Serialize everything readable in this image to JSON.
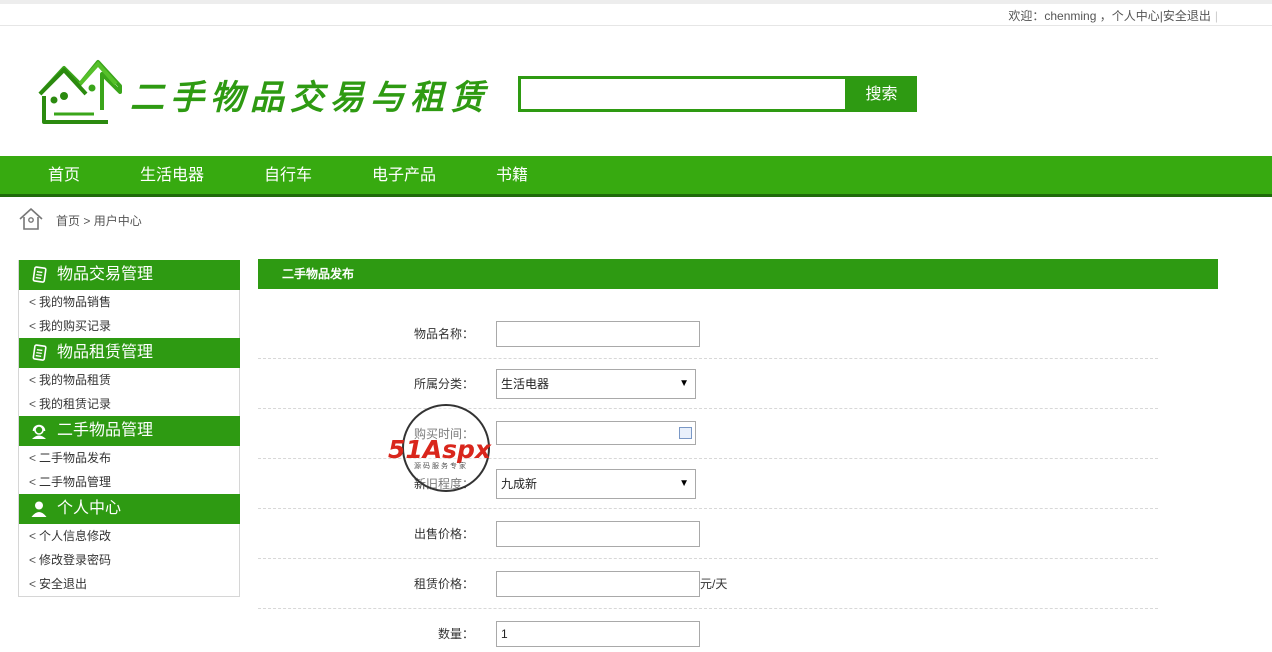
{
  "topbar": {
    "welcome": "欢迎：chenming ，",
    "user_center": "个人中心",
    "sep": "|",
    "logout": "安全退出",
    "tail": "|"
  },
  "header": {
    "site_title": "二手物品交易与租赁",
    "search_placeholder": "",
    "search_button": "搜索"
  },
  "nav": [
    "首页",
    "生活电器",
    "自行车",
    "电子产品",
    "书籍"
  ],
  "breadcrumb": {
    "home": "首页",
    "sep": ">",
    "current": "用户中心"
  },
  "sidebar": {
    "groups": [
      {
        "title": "物品交易管理",
        "icon": "document-icon",
        "items": [
          "我的物品销售",
          "我的购买记录"
        ]
      },
      {
        "title": "物品租赁管理",
        "icon": "document-icon",
        "items": [
          "我的物品租赁",
          "我的租赁记录"
        ]
      },
      {
        "title": "二手物品管理",
        "icon": "headset-user-icon",
        "items": [
          "二手物品发布",
          "二手物品管理"
        ]
      },
      {
        "title": "个人中心",
        "icon": "user-icon",
        "items": [
          "个人信息修改",
          "修改登录密码",
          "安全退出"
        ]
      }
    ],
    "chevron": "<"
  },
  "form": {
    "title": "二手物品发布",
    "fields": {
      "name": {
        "label": "物品名称：",
        "value": ""
      },
      "category": {
        "label": "所属分类：",
        "value": "生活电器"
      },
      "buy_date": {
        "label": "购买时间：",
        "value": ""
      },
      "condition": {
        "label": "新旧程度：",
        "value": "九成新"
      },
      "sale_price": {
        "label": "出售价格：",
        "value": ""
      },
      "rent_price": {
        "label": "租赁价格：",
        "value": "",
        "unit": "元/天"
      },
      "quantity": {
        "label": "数量：",
        "value": "1"
      }
    }
  },
  "watermark": {
    "brand": "51Aspx",
    "tagline": "源码服务专家"
  },
  "colors": {
    "primary": "#2e9a12",
    "nav": "#37aa10",
    "nav_border": "#1f6b0a",
    "watermark_red": "#d9261c"
  }
}
